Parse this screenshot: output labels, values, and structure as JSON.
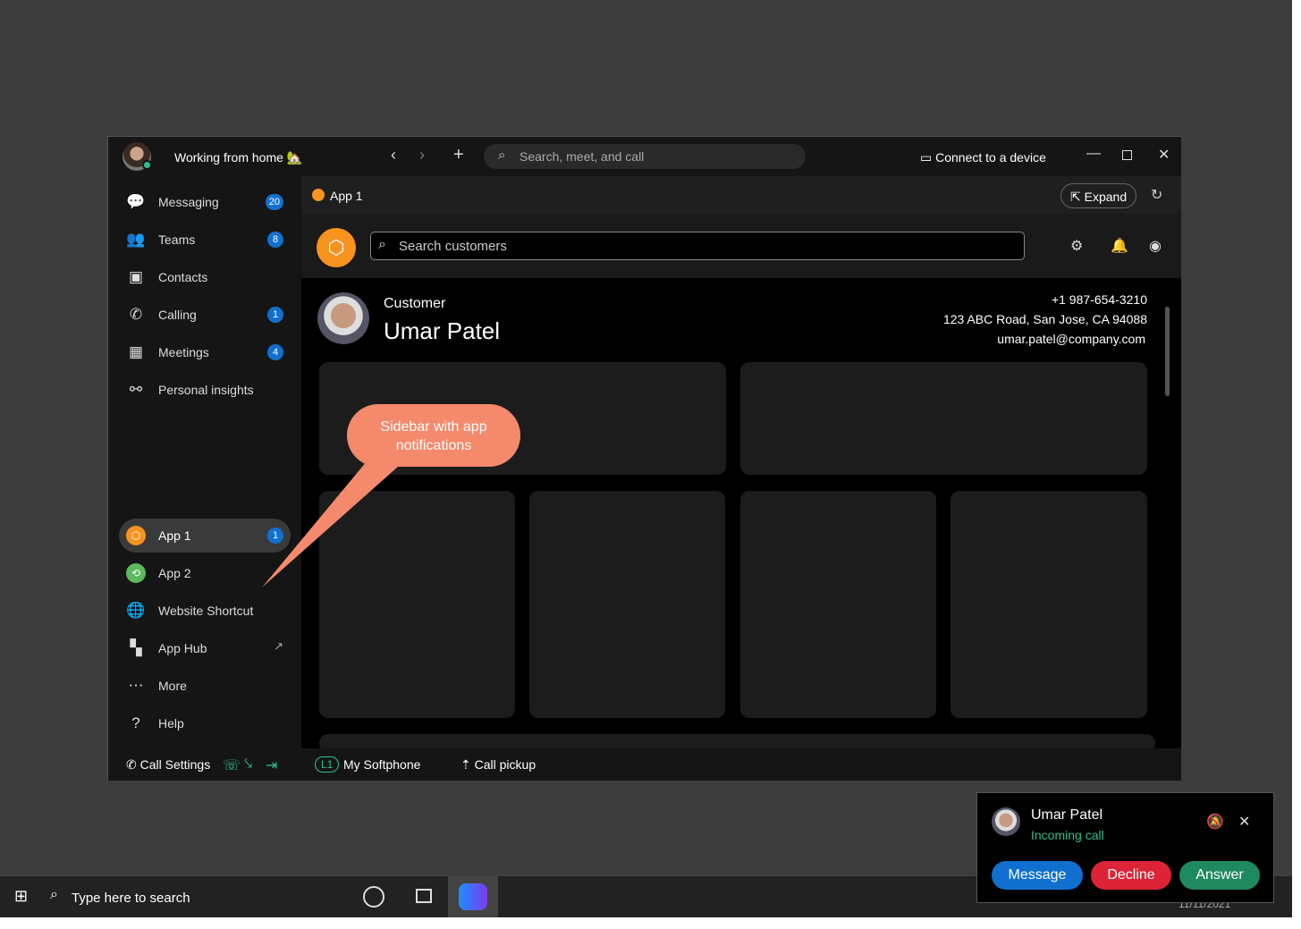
{
  "titlebar": {
    "status": "Working from home 🏡",
    "search_placeholder": "Search, meet, and call",
    "connect": "Connect to a device"
  },
  "sidebar": {
    "items": [
      {
        "label": "Messaging",
        "badge": "20",
        "icon": "chat-bubble-icon"
      },
      {
        "label": "Teams",
        "badge": "8",
        "icon": "people-icon"
      },
      {
        "label": "Contacts",
        "badge": null,
        "icon": "contacts-icon"
      },
      {
        "label": "Calling",
        "badge": "1",
        "icon": "phone-icon"
      },
      {
        "label": "Meetings",
        "badge": "4",
        "icon": "calendar-icon"
      },
      {
        "label": "Personal insights",
        "badge": null,
        "icon": "insights-icon"
      }
    ],
    "apps": [
      {
        "label": "App 1",
        "badge": "1"
      },
      {
        "label": "App 2"
      },
      {
        "label": "Website Shortcut"
      },
      {
        "label": "App Hub"
      },
      {
        "label": "More"
      },
      {
        "label": "Help"
      }
    ]
  },
  "app": {
    "tab": "App 1",
    "expand": "Expand",
    "search_placeholder": "Search customers",
    "customer": {
      "label": "Customer",
      "name": "Umar Patel",
      "phone": "+1 987-654-3210",
      "address": "123 ABC Road, San Jose, CA 94088",
      "email": "umar.patel@company.com"
    }
  },
  "callout": "Sidebar with app notifications",
  "bottombar": {
    "call_settings": "Call Settings",
    "line": "L1",
    "softphone": "My Softphone",
    "pickup": "Call pickup"
  },
  "taskbar": {
    "search": "Type here to search",
    "date": "11/11/2021"
  },
  "popup": {
    "name": "Umar Patel",
    "status": "Incoming call",
    "message": "Message",
    "decline": "Decline",
    "answer": "Answer"
  },
  "colors": {
    "accent": "#1170cf",
    "decline": "#dc2436",
    "answer": "#1f8a5f",
    "incoming": "#2fbf8f",
    "app_orange": "#f7931e",
    "callout": "#f4896b"
  }
}
